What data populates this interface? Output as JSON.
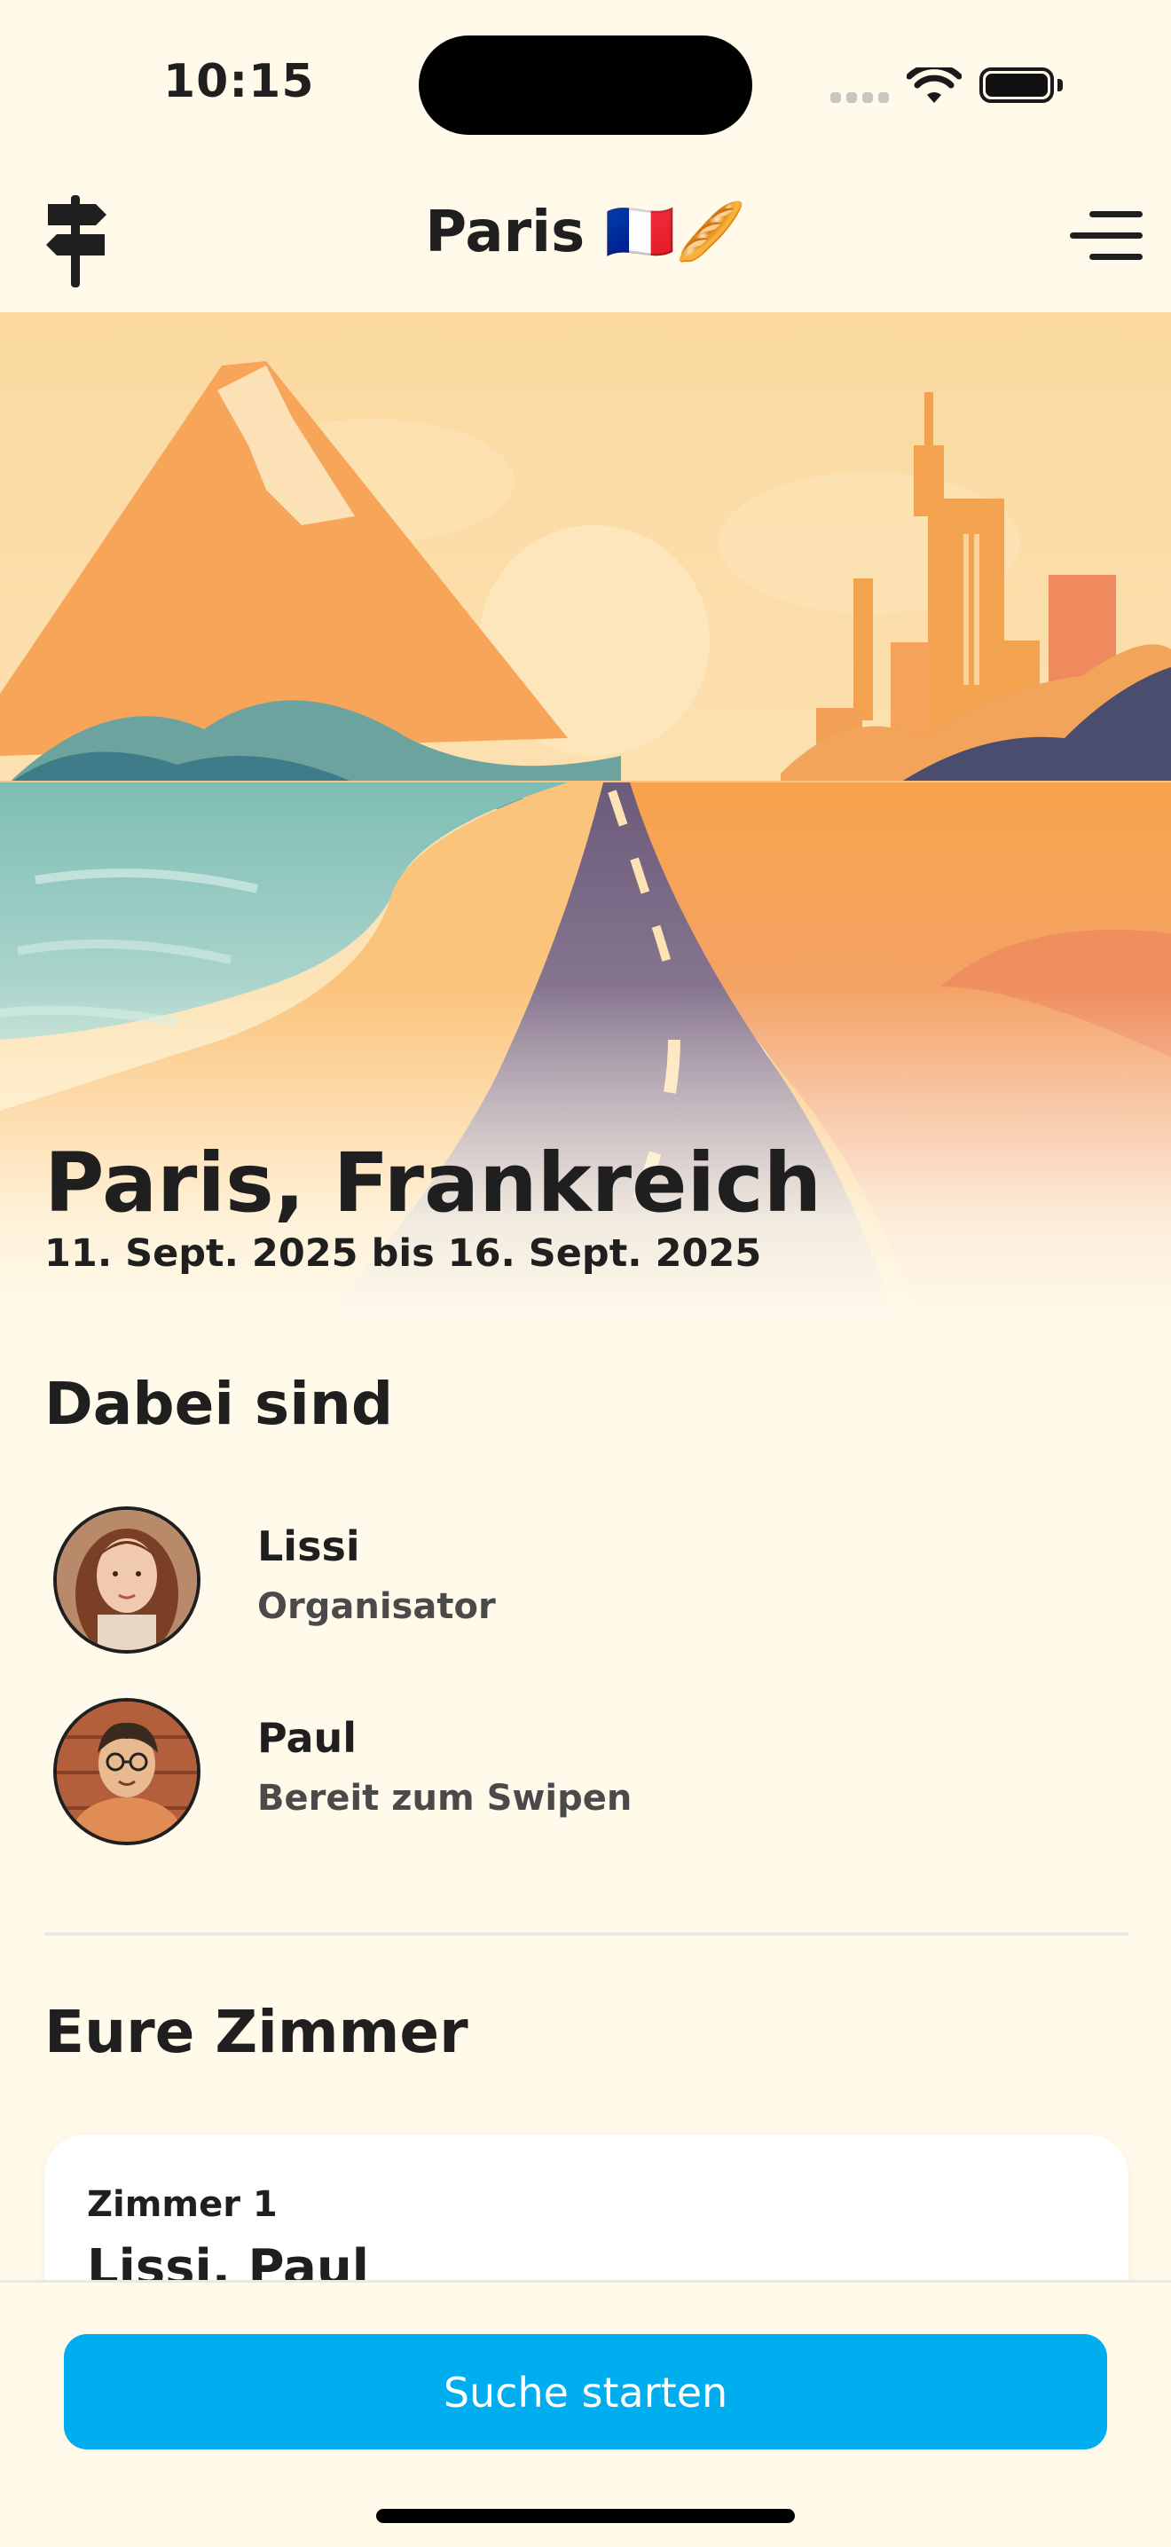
{
  "status_bar": {
    "time": "10:15"
  },
  "nav": {
    "title": "Paris 🇫🇷🥖"
  },
  "trip": {
    "title": "Paris, Frankreich",
    "dates": "11. Sept. 2025 bis 16. Sept. 2025"
  },
  "participants_section": {
    "title": "Dabei sind",
    "people": [
      {
        "name": "Lissi",
        "role": "Organisator"
      },
      {
        "name": "Paul",
        "role": "Bereit zum Swipen"
      }
    ]
  },
  "rooms_section": {
    "title": "Eure Zimmer",
    "rooms": [
      {
        "label": "Zimmer 1",
        "members": "Lissi, Paul"
      }
    ]
  },
  "cta": {
    "label": "Suche starten"
  },
  "colors": {
    "background": "#fffaea",
    "accent": "#00adef",
    "text": "#1f1f1f"
  },
  "icons": {
    "left_nav": "signpost-icon",
    "right_nav": "menu-icon"
  }
}
